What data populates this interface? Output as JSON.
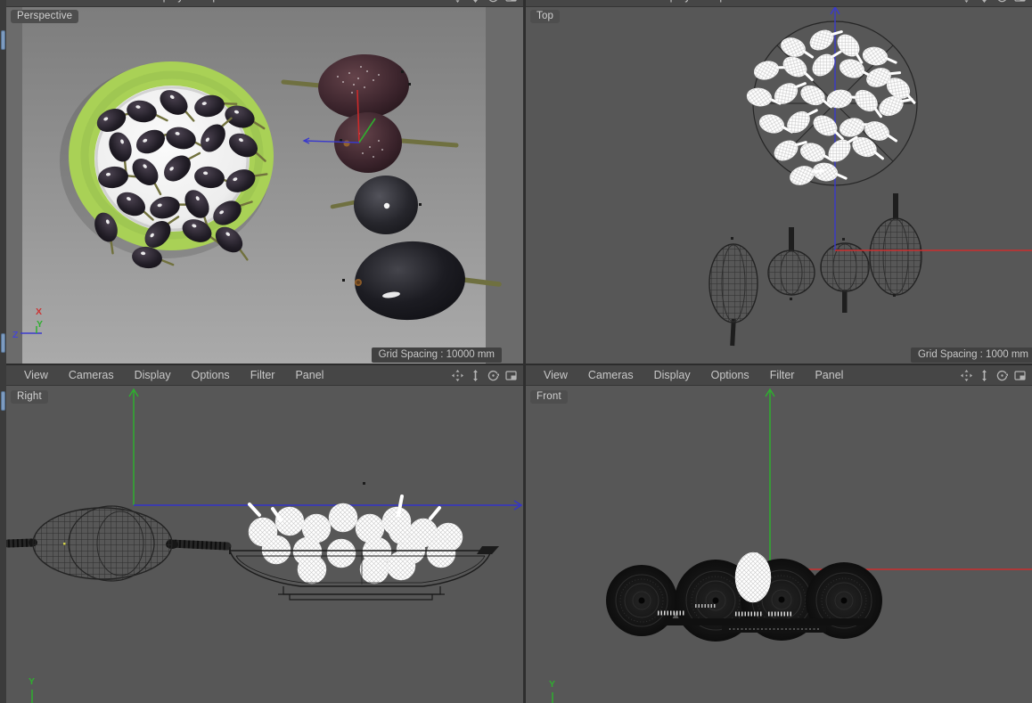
{
  "app": {
    "name": "3d-viewport-quad-layout"
  },
  "menu": {
    "items": [
      "View",
      "Cameras",
      "Display",
      "Options",
      "Filter",
      "Panel"
    ]
  },
  "viewport_icons": [
    "pan",
    "dolly",
    "rotate",
    "toggle-layout"
  ],
  "viewports": {
    "perspective": {
      "label": "Perspective",
      "grid_spacing": "Grid Spacing : 10000 mm"
    },
    "top": {
      "label": "Top",
      "grid_spacing": "Grid Spacing : 1000 mm"
    },
    "right": {
      "label": "Right"
    },
    "front": {
      "label": "Front"
    }
  },
  "axes": {
    "x": "X",
    "y": "Y",
    "z": "Z"
  },
  "colors": {
    "viewport_bg": "#575757",
    "perspective_bg": "#6b6b6b",
    "backdrop_top": "#7c7c7c",
    "backdrop_bottom": "#aaaaaa",
    "menubar_bg": "#464646",
    "menu_text": "#c9c9c9",
    "label_bg": "#4e4e4e",
    "label_text": "#d2d2d2",
    "axis_x_red": "#cc2e2e",
    "axis_y_green": "#2fae2f",
    "axis_z_blue": "#3a3acc",
    "plate_green": "#a9d156",
    "plate_white": "#f5f5f5",
    "olive_dark": "#1d1a20",
    "olive_maroon": "#553339",
    "stem_green": "#71713d",
    "selection_white": "#ffffff",
    "wireframe": "#2a2a2a",
    "rail_tab_blue": "#7d9bc0"
  },
  "scenes": {
    "perspective_plate_olives": [
      [
        118,
        135,
        -25
      ],
      [
        152,
        125,
        12
      ],
      [
        188,
        115,
        35
      ],
      [
        228,
        119,
        -12
      ],
      [
        262,
        131,
        18
      ],
      [
        128,
        165,
        70
      ],
      [
        162,
        159,
        -28
      ],
      [
        196,
        155,
        14
      ],
      [
        232,
        155,
        -55
      ],
      [
        266,
        163,
        28
      ],
      [
        120,
        199,
        -8
      ],
      [
        156,
        193,
        48
      ],
      [
        192,
        189,
        -42
      ],
      [
        228,
        199,
        8
      ],
      [
        263,
        203,
        -22
      ],
      [
        140,
        229,
        28
      ],
      [
        178,
        233,
        -14
      ],
      [
        214,
        229,
        58
      ],
      [
        248,
        239,
        -32
      ],
      [
        112,
        255,
        68
      ],
      [
        170,
        263,
        -48
      ],
      [
        214,
        259,
        22
      ],
      [
        158,
        289,
        8
      ],
      [
        250,
        269,
        40
      ]
    ],
    "top_cluster_olives": [
      [
        300,
        53,
        20
      ],
      [
        332,
        45,
        -30
      ],
      [
        362,
        51,
        45
      ],
      [
        392,
        63,
        10
      ],
      [
        270,
        79,
        -15
      ],
      [
        302,
        75,
        30
      ],
      [
        334,
        73,
        -45
      ],
      [
        366,
        77,
        15
      ],
      [
        396,
        87,
        -20
      ],
      [
        418,
        99,
        35
      ],
      [
        262,
        109,
        10
      ],
      [
        292,
        105,
        -35
      ],
      [
        322,
        107,
        25
      ],
      [
        352,
        111,
        -10
      ],
      [
        382,
        113,
        40
      ],
      [
        410,
        119,
        -25
      ],
      [
        276,
        139,
        15
      ],
      [
        306,
        137,
        -40
      ],
      [
        336,
        141,
        30
      ],
      [
        366,
        143,
        -15
      ],
      [
        394,
        147,
        20
      ],
      [
        292,
        169,
        -30
      ],
      [
        322,
        171,
        15
      ],
      [
        352,
        169,
        -45
      ],
      [
        380,
        165,
        25
      ],
      [
        336,
        193,
        10
      ],
      [
        310,
        197,
        -20
      ]
    ],
    "right_pile_olives": [
      [
        288,
        187
      ],
      [
        318,
        175
      ],
      [
        348,
        183
      ],
      [
        378,
        171
      ],
      [
        408,
        183
      ],
      [
        438,
        175
      ],
      [
        468,
        188
      ],
      [
        496,
        193
      ],
      [
        303,
        207
      ],
      [
        338,
        209
      ],
      [
        376,
        211
      ],
      [
        416,
        209
      ],
      [
        454,
        207
      ],
      [
        488,
        211
      ],
      [
        343,
        229
      ],
      [
        413,
        229
      ],
      [
        443,
        225
      ]
    ]
  }
}
